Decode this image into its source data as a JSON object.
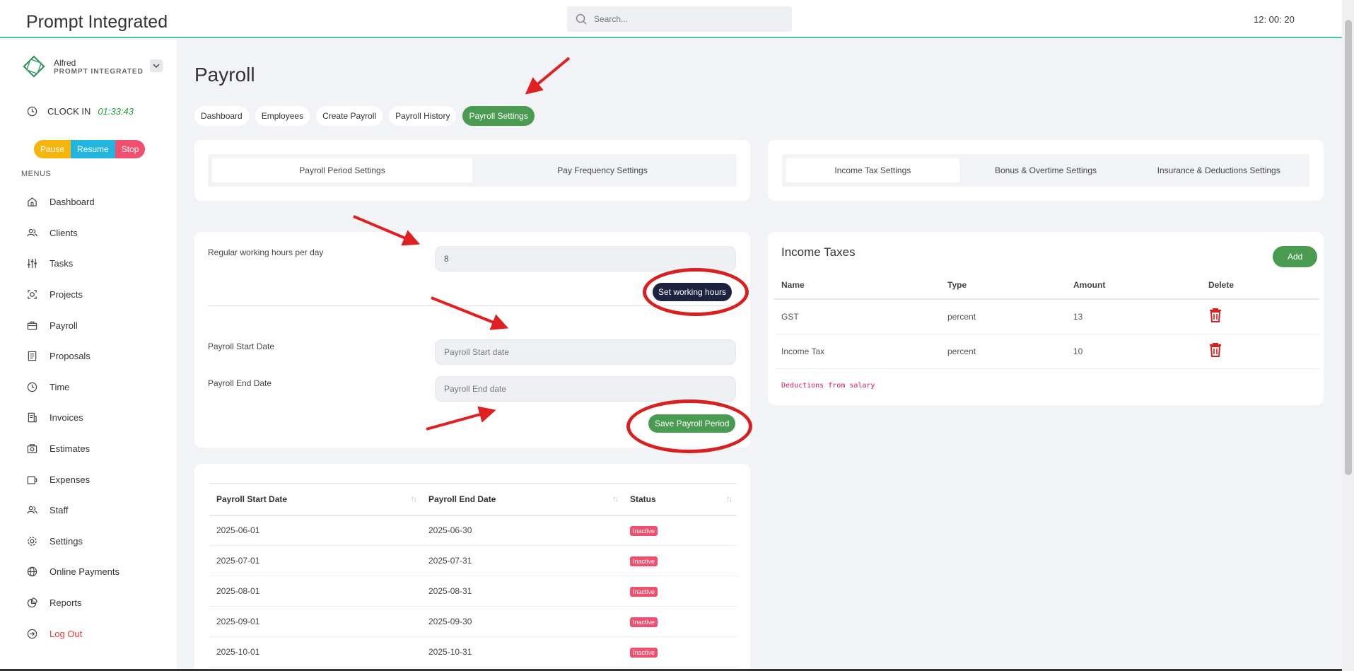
{
  "app": {
    "title": "Prompt Integrated",
    "time": "12: 00: 20"
  },
  "search": {
    "placeholder": "Search..."
  },
  "user": {
    "name": "Alfred",
    "org": "PROMPT INTEGRATED"
  },
  "clockin": {
    "label": "CLOCK IN",
    "timer": "01:33:43"
  },
  "timer_controls": {
    "pause": "Pause",
    "resume": "Resume",
    "stop": "Stop"
  },
  "sidebar": {
    "menus_title": "MENUS",
    "items": [
      {
        "label": "Dashboard",
        "icon": "home-icon"
      },
      {
        "label": "Clients",
        "icon": "users-icon"
      },
      {
        "label": "Tasks",
        "icon": "sliders-icon"
      },
      {
        "label": "Projects",
        "icon": "projects-icon"
      },
      {
        "label": "Payroll",
        "icon": "briefcase-icon"
      },
      {
        "label": "Proposals",
        "icon": "document-icon"
      },
      {
        "label": "Time",
        "icon": "clock-icon"
      },
      {
        "label": "Invoices",
        "icon": "invoice-icon"
      },
      {
        "label": "Estimates",
        "icon": "estimate-icon"
      },
      {
        "label": "Expenses",
        "icon": "wallet-icon"
      },
      {
        "label": "Staff",
        "icon": "staff-icon"
      },
      {
        "label": "Settings",
        "icon": "gear-icon"
      },
      {
        "label": "Online Payments",
        "icon": "globe-icon"
      },
      {
        "label": "Reports",
        "icon": "pie-chart-icon"
      },
      {
        "label": "Log Out",
        "icon": "logout-icon"
      }
    ]
  },
  "page": {
    "title": "Payroll"
  },
  "tabs": [
    "Dashboard",
    "Employees",
    "Create Payroll",
    "Payroll History",
    "Payroll Settings"
  ],
  "active_tab": "Payroll Settings",
  "left_segment": [
    "Payroll Period Settings",
    "Pay Frequency Settings"
  ],
  "right_segment": [
    "Income Tax Settings",
    "Bonus & Overtime Settings",
    "Insurance & Deductions Settings"
  ],
  "form": {
    "working_hours_label": "Regular working hours per day",
    "working_hours_value": "8",
    "set_hours_button": "Set working hours",
    "start_label": "Payroll Start Date",
    "start_placeholder": "Payroll Start date",
    "end_label": "Payroll End Date",
    "end_placeholder": "Payroll End date",
    "save_button": "Save Payroll Period"
  },
  "periods": {
    "headers": [
      "Payroll Start Date",
      "Payroll End Date",
      "Status"
    ],
    "rows": [
      {
        "start": "2025-06-01",
        "end": "2025-06-30",
        "status": "Inactive"
      },
      {
        "start": "2025-07-01",
        "end": "2025-07-31",
        "status": "Inactive"
      },
      {
        "start": "2025-08-01",
        "end": "2025-08-31",
        "status": "Inactive"
      },
      {
        "start": "2025-09-01",
        "end": "2025-09-30",
        "status": "Inactive"
      },
      {
        "start": "2025-10-01",
        "end": "2025-10-31",
        "status": "Inactive"
      }
    ]
  },
  "income_taxes": {
    "title": "Income Taxes",
    "add_button": "Add",
    "headers": [
      "Name",
      "Type",
      "Amount",
      "Delete"
    ],
    "rows": [
      {
        "name": "GST",
        "type": "percent",
        "amount": "13"
      },
      {
        "name": "Income Tax",
        "type": "percent",
        "amount": "10"
      }
    ],
    "note": "Deductions from salary"
  },
  "colors": {
    "accent_green": "#4a9a52",
    "badge_red": "#f0506e",
    "annotation_red": "#d82020",
    "dark_button": "#1c2240"
  }
}
